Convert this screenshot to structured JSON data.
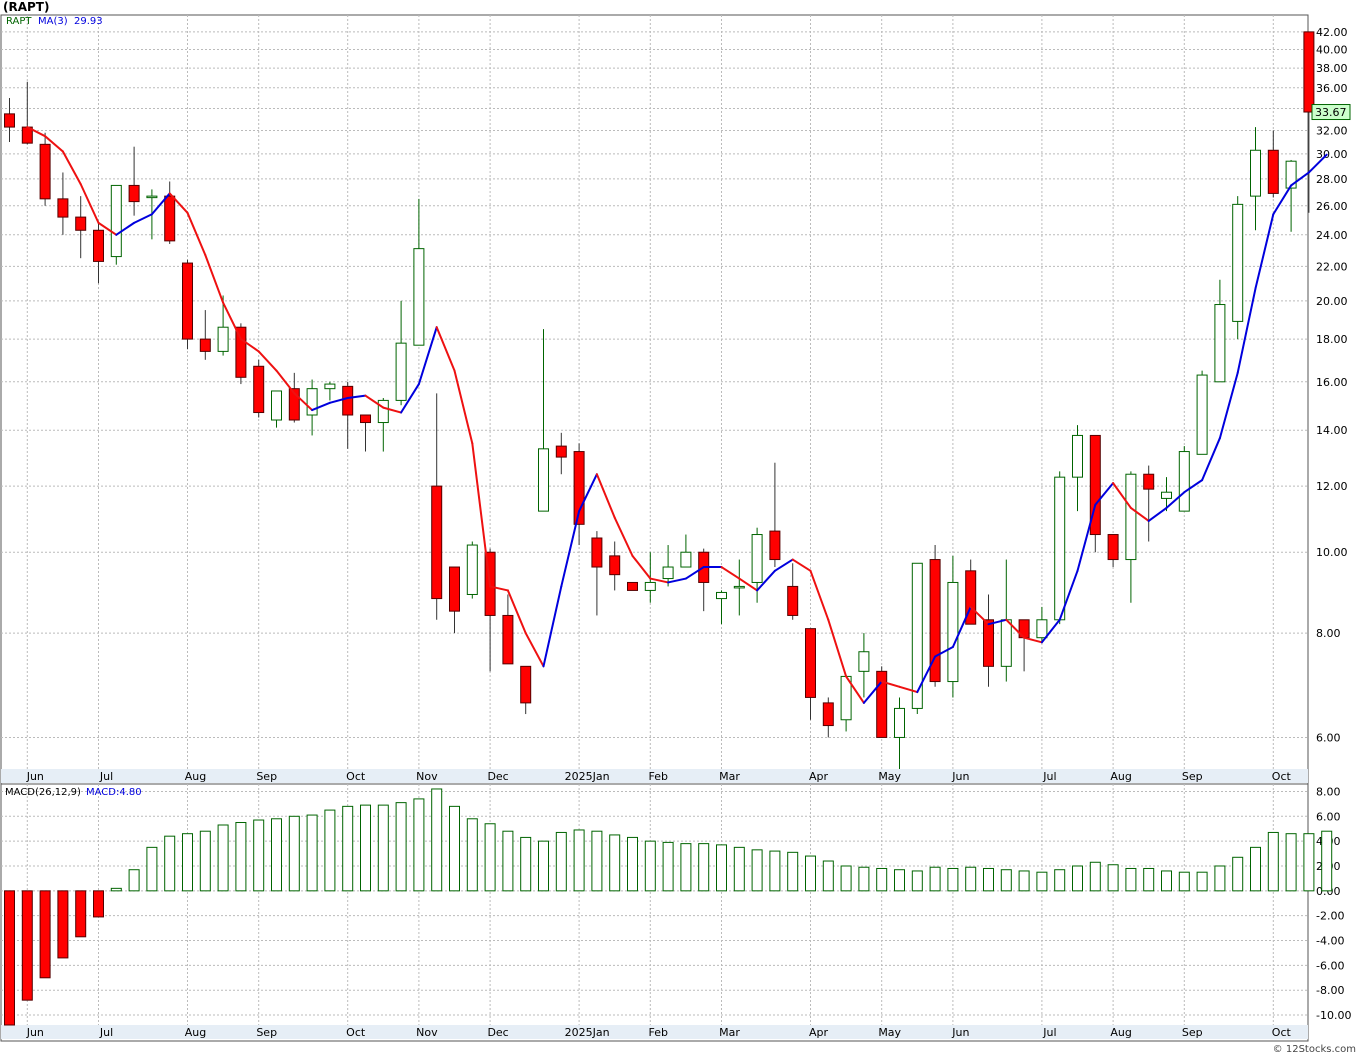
{
  "title": "(RAPT)",
  "watermark": "© 12Stocks.com",
  "legend": {
    "ticker": "RAPT",
    "ma_label": "MA(3)",
    "ma_value": "29.93",
    "macd_name": "MACD(26,12,9)",
    "macd_value": "MACD:4.80",
    "last_price": "33.67"
  },
  "colors": {
    "up_candle": "#006400",
    "down_candle": "#ff0000",
    "ma_up": "#0000dd",
    "ma_down": "#ee1111",
    "macd_bar": "#006400",
    "macd_neg": "#ff0000",
    "grid": "#bbbbbb",
    "axis_bar": "#e6eef6",
    "last_price_box": "#ccffcc"
  },
  "chart_data": [
    {
      "type": "candlestick",
      "scale": "log",
      "ylim": [
        5.5,
        44
      ],
      "y_ticks": [
        "42.00",
        "40.00",
        "38.00",
        "36.00",
        "34.00",
        "32.00",
        "30.00",
        "28.00",
        "26.00",
        "24.00",
        "22.00",
        "20.00",
        "18.00",
        "16.00",
        "14.00",
        "12.00",
        "10.00",
        "8.00",
        "6.00"
      ],
      "x_labels": [
        "Jun",
        "Jul",
        "Aug",
        "Sep",
        "Oct",
        "Nov",
        "Dec",
        "2025Jan",
        "Feb",
        "Mar",
        "Apr",
        "May",
        "Jun",
        "Jul",
        "Aug",
        "Sep",
        "Oct"
      ],
      "label_index": [
        1,
        5,
        10,
        14,
        19,
        23,
        27,
        32,
        36,
        40,
        45,
        49,
        53,
        58,
        62,
        66,
        71
      ],
      "candles": [
        [
          33.5,
          35,
          31,
          32.3
        ],
        [
          32.3,
          36.6,
          30.8,
          30.9
        ],
        [
          30.8,
          31.8,
          26,
          26.5
        ],
        [
          26.5,
          28.5,
          24,
          25.2
        ],
        [
          25.2,
          26.7,
          22.5,
          24.3
        ],
        [
          24.3,
          24.8,
          21,
          22.3
        ],
        [
          22.6,
          24.5,
          22.1,
          27.5
        ],
        [
          27.5,
          30.6,
          25.3,
          26.3
        ],
        [
          26.6,
          27.2,
          23.7,
          26.7
        ],
        [
          26.7,
          27.8,
          23.4,
          23.6
        ],
        [
          22.2,
          22.4,
          17.5,
          18
        ],
        [
          18,
          19.5,
          17,
          17.4
        ],
        [
          17.4,
          20.3,
          17.2,
          18.6
        ],
        [
          18.6,
          18.8,
          15.9,
          16.2
        ],
        [
          16.7,
          17,
          14.5,
          14.7
        ],
        [
          14.4,
          15.3,
          14.1,
          15.6
        ],
        [
          15.7,
          16.4,
          14.3,
          14.4
        ],
        [
          14.6,
          16.1,
          13.8,
          15.7
        ],
        [
          15.7,
          16,
          15.2,
          15.9
        ],
        [
          15.8,
          16,
          13.3,
          14.6
        ],
        [
          14.6,
          14.6,
          13.2,
          14.3
        ],
        [
          14.3,
          15.3,
          13.2,
          15.2
        ],
        [
          15.2,
          20,
          15,
          17.8
        ],
        [
          17.7,
          26.5,
          17.7,
          23.1
        ],
        [
          12,
          15.5,
          8.3,
          8.8
        ],
        [
          9.6,
          9.6,
          8,
          8.5
        ],
        [
          8.9,
          10.3,
          8.8,
          10.2
        ],
        [
          10,
          10.1,
          7.2,
          8.4
        ],
        [
          8.4,
          8.9,
          7.4,
          7.35
        ],
        [
          7.3,
          7.3,
          6.4,
          6.6
        ],
        [
          11.2,
          18.5,
          11.2,
          13.3
        ],
        [
          13.4,
          13.9,
          12.4,
          13
        ],
        [
          13.2,
          13.5,
          10.2,
          10.8
        ],
        [
          10.4,
          10.6,
          8.4,
          9.6
        ],
        [
          9.9,
          10.3,
          9,
          9.4
        ],
        [
          9.2,
          9.2,
          9,
          9
        ],
        [
          9,
          10,
          8.7,
          9.2
        ],
        [
          9.3,
          10.2,
          9.1,
          9.6
        ],
        [
          9.6,
          10.5,
          9.6,
          10
        ],
        [
          10,
          10.1,
          8.5,
          9.2
        ],
        [
          8.8,
          9,
          8.2,
          8.95
        ],
        [
          9.1,
          9.8,
          8.4,
          9.1
        ],
        [
          9.2,
          10.7,
          8.7,
          10.5
        ],
        [
          10.6,
          12.8,
          9.6,
          9.8
        ],
        [
          9.1,
          9.7,
          8.3,
          8.4
        ],
        [
          8.1,
          8.1,
          6.3,
          6.7
        ],
        [
          6.6,
          6.7,
          6,
          6.2
        ],
        [
          6.3,
          7.1,
          6.1,
          7.1
        ],
        [
          7.2,
          8,
          6.7,
          7.6
        ],
        [
          7.2,
          7.3,
          6,
          6
        ],
        [
          6,
          6.7,
          5.5,
          6.5
        ],
        [
          6.5,
          9.7,
          6.4,
          9.7
        ],
        [
          9.8,
          10.2,
          6.9,
          7
        ],
        [
          7,
          9.9,
          6.7,
          9.2
        ],
        [
          9.5,
          9.8,
          8.2,
          8.2
        ],
        [
          8.3,
          8.9,
          6.9,
          7.3
        ],
        [
          7.3,
          9.8,
          7,
          8.3
        ],
        [
          8.3,
          8.3,
          7.2,
          7.9
        ],
        [
          7.9,
          8.6,
          7.8,
          8.3
        ],
        [
          8.3,
          12.5,
          8.2,
          12.3
        ],
        [
          12.3,
          14.2,
          11.2,
          13.8
        ],
        [
          13.8,
          13.8,
          10,
          10.5
        ],
        [
          10.5,
          10.5,
          9.6,
          9.8
        ],
        [
          9.8,
          12.5,
          8.7,
          12.4
        ],
        [
          12.4,
          12.7,
          10.3,
          11.9
        ],
        [
          11.6,
          12.3,
          11.2,
          11.8
        ],
        [
          11.2,
          13.4,
          11.2,
          13.2
        ],
        [
          13.1,
          16.5,
          13.1,
          16.3
        ],
        [
          16,
          21.2,
          16,
          19.8
        ],
        [
          18.9,
          26.7,
          18,
          26.1
        ],
        [
          26.7,
          32.3,
          24.3,
          30.3
        ],
        [
          30.3,
          32,
          26.6,
          26.9
        ],
        [
          27.3,
          29.5,
          24.2,
          29.4
        ],
        [
          42,
          42,
          25.5,
          33.67
        ]
      ],
      "ma3": [
        [
          1,
          32.3
        ],
        [
          2,
          31.5
        ],
        [
          3,
          30.2
        ],
        [
          4,
          27.6
        ],
        [
          5,
          24.8
        ],
        [
          6,
          24
        ],
        [
          7,
          24.8
        ],
        [
          8,
          25.4
        ],
        [
          9,
          26.9
        ],
        [
          10,
          25.5
        ],
        [
          11,
          22.7
        ],
        [
          12,
          19.9
        ],
        [
          13,
          18
        ],
        [
          14,
          17.4
        ],
        [
          15,
          16.5
        ],
        [
          16,
          15.5
        ],
        [
          17,
          14.8
        ],
        [
          18,
          15.1
        ],
        [
          19,
          15.3
        ],
        [
          20,
          15.4
        ],
        [
          21,
          14.9
        ],
        [
          22,
          14.7
        ],
        [
          23,
          15.9
        ],
        [
          24,
          18.6
        ],
        [
          25,
          16.5
        ],
        [
          26,
          13.5
        ],
        [
          27,
          9.1
        ],
        [
          28,
          9
        ],
        [
          29,
          8
        ],
        [
          30,
          7.3
        ],
        [
          31,
          9.1
        ],
        [
          32,
          11.2
        ],
        [
          33,
          12.4
        ],
        [
          34,
          11
        ],
        [
          35,
          9.9
        ],
        [
          36,
          9.3
        ],
        [
          37,
          9.2
        ],
        [
          38,
          9.3
        ],
        [
          39,
          9.6
        ],
        [
          40,
          9.6
        ],
        [
          41,
          9.3
        ],
        [
          42,
          9
        ],
        [
          43,
          9.5
        ],
        [
          44,
          9.8
        ],
        [
          45,
          9.5
        ],
        [
          46,
          8.3
        ],
        [
          47,
          7.1
        ],
        [
          48,
          6.6
        ],
        [
          49,
          7
        ],
        [
          50,
          6.9
        ],
        [
          51,
          6.8
        ],
        [
          52,
          7.5
        ],
        [
          53,
          7.7
        ],
        [
          54,
          8.6
        ],
        [
          55,
          8.2
        ],
        [
          56,
          8.3
        ],
        [
          57,
          7.9
        ],
        [
          58,
          7.8
        ],
        [
          59,
          8.3
        ],
        [
          60,
          9.5
        ],
        [
          61,
          11.4
        ],
        [
          62,
          12.1
        ],
        [
          63,
          11.3
        ],
        [
          64,
          10.9
        ],
        [
          65,
          11.3
        ],
        [
          66,
          11.8
        ],
        [
          67,
          12.2
        ],
        [
          68,
          13.7
        ],
        [
          69,
          16.4
        ],
        [
          70,
          20.7
        ],
        [
          71,
          25.4
        ],
        [
          72,
          27.5
        ],
        [
          73,
          28.5
        ],
        [
          74,
          29.93
        ]
      ]
    },
    {
      "type": "bar",
      "series_name": "MACD(26,12,9)",
      "ylim": [
        -10.8,
        8.6
      ],
      "y_ticks": [
        "8.00",
        "6.00",
        "4.00",
        "2.00",
        "0.00",
        "-2.00",
        "-4.00",
        "-6.00",
        "-8.00",
        "-10.00"
      ],
      "x_labels": [
        "Jun",
        "Jul",
        "Aug",
        "Sep",
        "Oct",
        "Nov",
        "Dec",
        "2025Jan",
        "Feb",
        "Mar",
        "Apr",
        "May",
        "Jun",
        "Jul",
        "Aug",
        "Sep",
        "Oct"
      ],
      "label_index": [
        1,
        5,
        10,
        14,
        19,
        23,
        27,
        32,
        36,
        40,
        45,
        49,
        53,
        58,
        62,
        66,
        71
      ],
      "values": [
        -11,
        -8.8,
        -7,
        -5.4,
        -3.7,
        -2.1,
        0.2,
        1.7,
        3.5,
        4.4,
        4.6,
        4.8,
        5.3,
        5.5,
        5.7,
        5.8,
        6,
        6.1,
        6.5,
        6.8,
        6.9,
        6.9,
        7.1,
        7.4,
        8.2,
        6.8,
        5.8,
        5.4,
        4.8,
        4.3,
        4,
        4.7,
        4.9,
        4.8,
        4.5,
        4.3,
        4,
        3.9,
        3.8,
        3.8,
        3.7,
        3.5,
        3.3,
        3.2,
        3.1,
        2.8,
        2.4,
        2,
        1.9,
        1.8,
        1.7,
        1.6,
        1.9,
        1.8,
        1.9,
        1.8,
        1.7,
        1.6,
        1.5,
        1.7,
        2,
        2.3,
        2.1,
        1.8,
        1.8,
        1.6,
        1.5,
        1.5,
        2,
        2.7,
        3.5,
        4.7,
        4.6,
        4.6,
        4.8
      ]
    }
  ]
}
